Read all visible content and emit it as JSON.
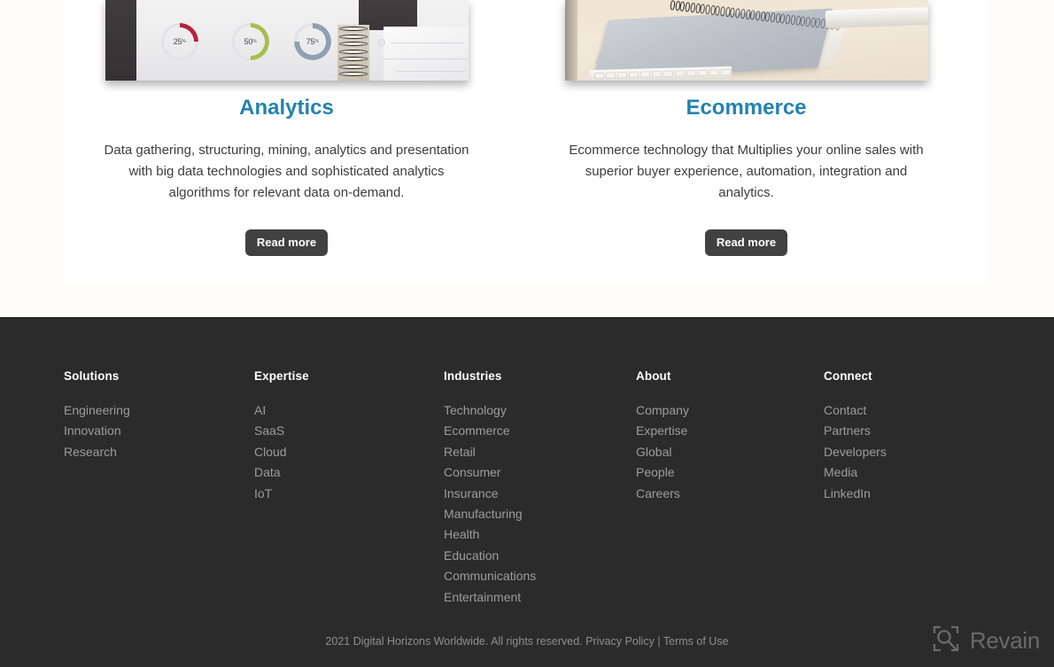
{
  "cards": [
    {
      "image_alt": "analytics-report-donut-charts-photo",
      "image_labels": [
        "25",
        "50",
        "75"
      ],
      "title": "Analytics",
      "description": "Data gathering, structuring, mining, analytics and presentation with big data technologies and sophisticated analytics algorithms for relevant data on-demand.",
      "button_label": "Read more"
    },
    {
      "image_alt": "spiral-notebook-on-desk-photo",
      "title": "Ecommerce",
      "description": "Ecommerce technology that Multiplies your online sales with superior buyer experience, automation, integration and analytics.",
      "button_label": "Read more"
    }
  ],
  "footer": {
    "columns": [
      {
        "title": "Solutions",
        "links": [
          "Engineering",
          "Innovation",
          "Research"
        ]
      },
      {
        "title": "Expertise",
        "links": [
          "AI",
          "SaaS",
          "Cloud",
          "Data",
          "IoT"
        ]
      },
      {
        "title": "Industries",
        "links": [
          "Technology",
          "Ecommerce",
          "Retail",
          "Consumer",
          "Insurance",
          "Manufacturing",
          "Health",
          "Education",
          "Communications",
          "Entertainment"
        ]
      },
      {
        "title": "About",
        "links": [
          "Company",
          "Expertise",
          "Global",
          "People",
          "Careers"
        ]
      },
      {
        "title": "Connect",
        "links": [
          "Contact",
          "Partners",
          "Developers",
          "Media",
          "LinkedIn"
        ]
      }
    ],
    "bottom": {
      "copyright": "2021 Digital Horizons Worldwide. All rights reserved.",
      "privacy_label": "Privacy Policy",
      "separator": "|",
      "terms_label": "Terms of Use"
    }
  },
  "watermark": {
    "label": "Revain",
    "icon": "revain-logo-icon"
  },
  "colors": {
    "heading": "#2283ae",
    "button_bg": "#414141",
    "footer_bg": "#2b2b2b",
    "footer_link": "#9c9c9c",
    "page_bg": "#fffdfb"
  }
}
